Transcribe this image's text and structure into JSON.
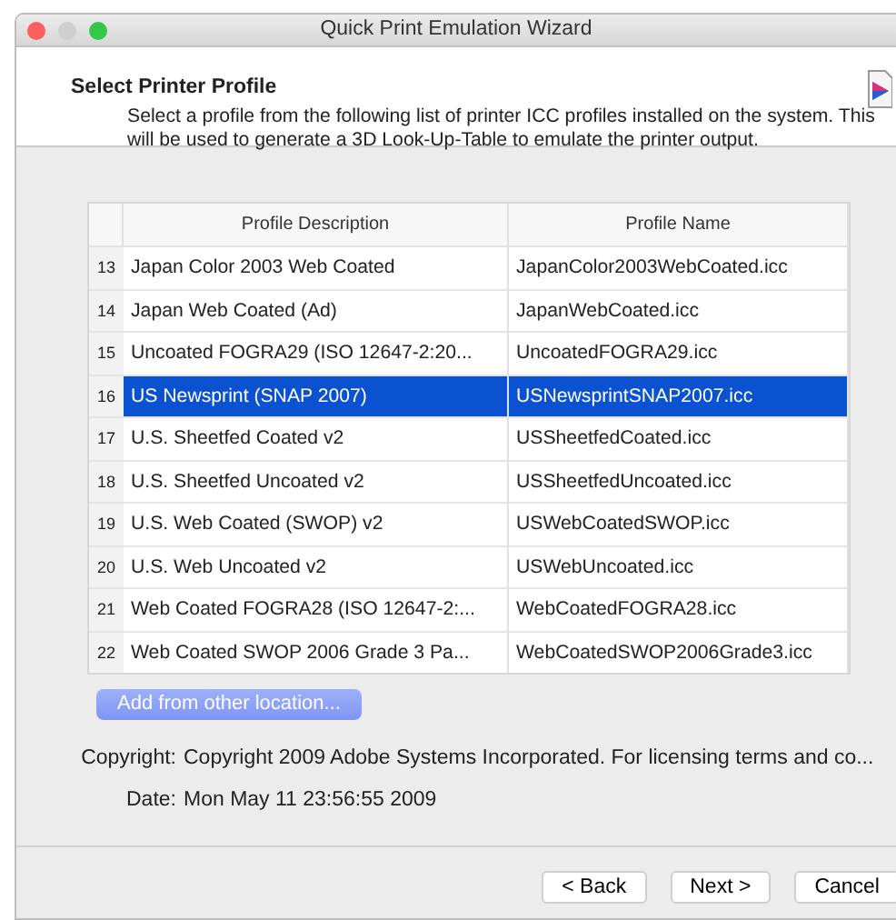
{
  "window": {
    "title": "Quick Print Emulation Wizard"
  },
  "header": {
    "title": "Select Printer Profile",
    "description": "Select a profile from the following list of printer ICC profiles installed on the system. This will be used to generate a 3D Look-Up-Table to emulate the printer output."
  },
  "table": {
    "columns": [
      "Profile Description",
      "Profile Name"
    ],
    "rows": [
      {
        "number": "13",
        "description": "Japan Color 2003 Web Coated",
        "name": "JapanColor2003WebCoated.icc",
        "selected": false
      },
      {
        "number": "14",
        "description": "Japan Web Coated (Ad)",
        "name": "JapanWebCoated.icc",
        "selected": false
      },
      {
        "number": "15",
        "description": "Uncoated FOGRA29 (ISO 12647-2:20...",
        "name": "UncoatedFOGRA29.icc",
        "selected": false
      },
      {
        "number": "16",
        "description": "US Newsprint (SNAP 2007)",
        "name": "USNewsprintSNAP2007.icc",
        "selected": true
      },
      {
        "number": "17",
        "description": "U.S. Sheetfed Coated v2",
        "name": "USSheetfedCoated.icc",
        "selected": false
      },
      {
        "number": "18",
        "description": "U.S. Sheetfed Uncoated v2",
        "name": "USSheetfedUncoated.icc",
        "selected": false
      },
      {
        "number": "19",
        "description": "U.S. Web Coated (SWOP) v2",
        "name": "USWebCoatedSWOP.icc",
        "selected": false
      },
      {
        "number": "20",
        "description": "U.S. Web Uncoated v2",
        "name": "USWebUncoated.icc",
        "selected": false
      },
      {
        "number": "21",
        "description": "Web Coated FOGRA28 (ISO 12647-2:...",
        "name": "WebCoatedFOGRA28.icc",
        "selected": false
      },
      {
        "number": "22",
        "description": "Web Coated SWOP 2006 Grade 3 Pa...",
        "name": "WebCoatedSWOP2006Grade3.icc",
        "selected": false
      }
    ]
  },
  "add_button": "Add from other location...",
  "details": [
    {
      "label": "Copyright:",
      "value": "Copyright 2009 Adobe Systems Incorporated. For licensing terms and co..."
    },
    {
      "label": "Date:",
      "value": "Mon May 11 23:56:55 2009"
    }
  ],
  "buttons": [
    "< Back",
    "Next >",
    "Cancel"
  ]
}
